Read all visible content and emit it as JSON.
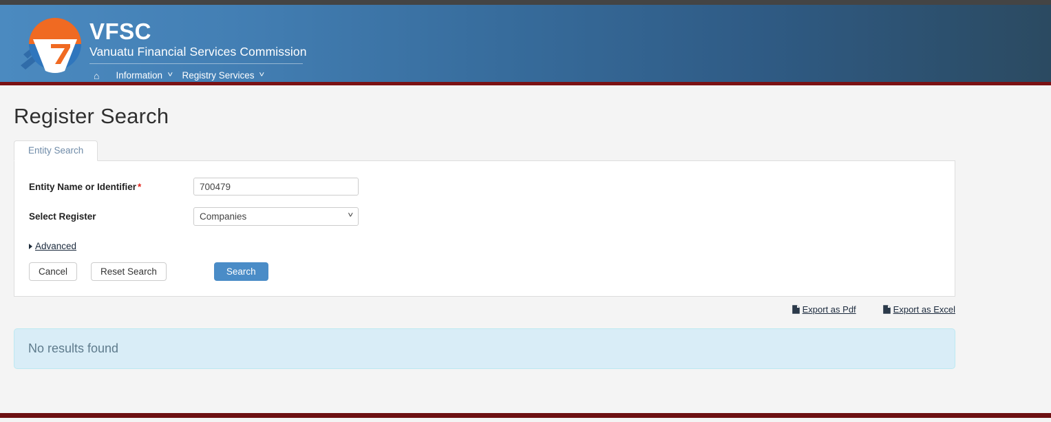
{
  "header": {
    "logo_alt": "vfsc-logo",
    "brand_title": "VFSC",
    "brand_subtitle": "Vanuatu Financial Services Commission",
    "nav": [
      {
        "name": "home",
        "label": "",
        "icon": "home-icon",
        "has_caret": false
      },
      {
        "name": "information",
        "label": "Information",
        "icon": "",
        "has_caret": true
      },
      {
        "name": "registry-services",
        "label": "Registry Services",
        "icon": "",
        "has_caret": true
      }
    ],
    "home_glyph": "⌂",
    "caret_glyph": "˅",
    "gradient_left": "#4b8ac0",
    "gradient_right": "#2b4a61",
    "rule_color": "#7b1113"
  },
  "page": {
    "title": "Register Search",
    "background": "#f4f4f4"
  },
  "tabs": [
    {
      "name": "entity-search",
      "label": "Entity Search",
      "active": true
    }
  ],
  "form": {
    "fields": [
      {
        "name": "entity-name-or-identifier",
        "label": "Entity Name or Identifier",
        "required": true,
        "required_marker": "*",
        "type": "text",
        "value": "700479",
        "placeholder": ""
      },
      {
        "name": "select-register",
        "label": "Select Register",
        "required": false,
        "required_marker": "",
        "type": "select",
        "value": "Companies",
        "options": [
          "Companies"
        ]
      }
    ],
    "advanced_label": "Advanced",
    "buttons": {
      "cancel": "Cancel",
      "reset": "Reset Search",
      "search": "Search"
    },
    "primary_color": "#4a8cc7"
  },
  "export": {
    "pdf_label": "Export as Pdf",
    "excel_label": "Export as Excel",
    "icon": "document-icon"
  },
  "results": {
    "message": "No results found",
    "background": "#d9edf7",
    "border": "#bce8f1",
    "text_color": "#5e7b8c"
  },
  "footer": {
    "rule_color": "#6d1012"
  }
}
